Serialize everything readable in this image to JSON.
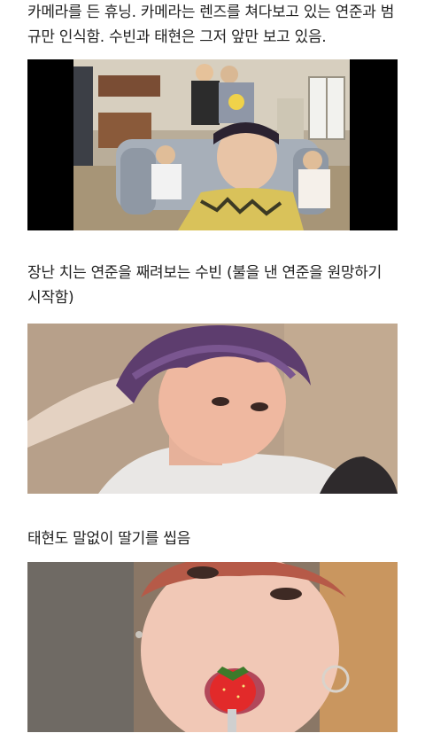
{
  "post": {
    "captions": [
      "카메라를 든 휴닝. 카메라는 렌즈를 쳐다보고 있는 연준과 범규만 인식함. 수빈과 태현은 그저 앞만 보고 있음.",
      "장난 치는 연준을 째려보는 수빈 (불을 낸 연준을 원망하기 시작함)",
      "태현도 말없이 딸기를 씹음"
    ]
  },
  "colors": {
    "text": "#222222",
    "background": "#ffffff",
    "letterbox": "#000000"
  }
}
